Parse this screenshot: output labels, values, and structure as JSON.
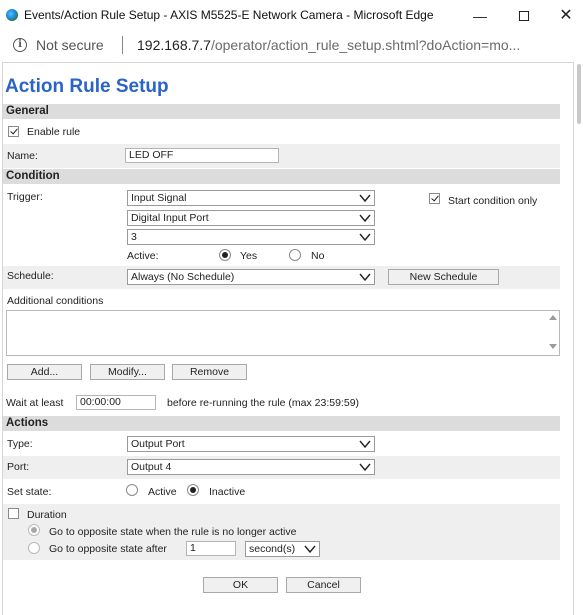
{
  "window": {
    "title": "Events/Action Rule Setup - AXIS M5525-E Network Camera - Microsoft Edge",
    "minimize": "—",
    "close": "✕"
  },
  "addressbar": {
    "security": "Not secure",
    "url_host": "192.168.7.7",
    "url_path": "/operator/action_rule_setup.shtml?doAction=mo..."
  },
  "page": {
    "heading": "Action Rule Setup",
    "general": {
      "section_title": "General",
      "enable_rule_label": "Enable rule",
      "enable_rule_checked": true,
      "name_label": "Name:",
      "name_value": "LED OFF"
    },
    "condition": {
      "section_title": "Condition",
      "trigger_label": "Trigger:",
      "trigger_value": "Input Signal",
      "trigger_sub_value": "Digital Input Port",
      "port_value": "3",
      "start_condition_label": "Start condition only",
      "start_condition_checked": true,
      "active_label": "Active:",
      "active_yes_label": "Yes",
      "active_no_label": "No",
      "active_selected": "Yes",
      "schedule_label": "Schedule:",
      "schedule_value": "Always (No Schedule)",
      "new_schedule_button": "New Schedule",
      "additional_conditions_label": "Additional conditions",
      "add_button": "Add...",
      "modify_button": "Modify...",
      "remove_button": "Remove",
      "wait_label": "Wait at least",
      "wait_value": "00:00:00",
      "wait_suffix": "before re-running the rule (max 23:59:59)"
    },
    "actions": {
      "section_title": "Actions",
      "type_label": "Type:",
      "type_value": "Output Port",
      "port_label": "Port:",
      "port_value": "Output 4",
      "set_state_label": "Set state:",
      "state_active_label": "Active",
      "state_inactive_label": "Inactive",
      "state_selected": "Inactive",
      "duration_label": "Duration",
      "duration_checked": false,
      "opposite_when_label": "Go to opposite state when the rule is no longer active",
      "opposite_after_label": "Go to opposite state after",
      "opposite_after_value": "1",
      "unit_value": "second(s)"
    },
    "ok_button": "OK",
    "cancel_button": "Cancel"
  }
}
